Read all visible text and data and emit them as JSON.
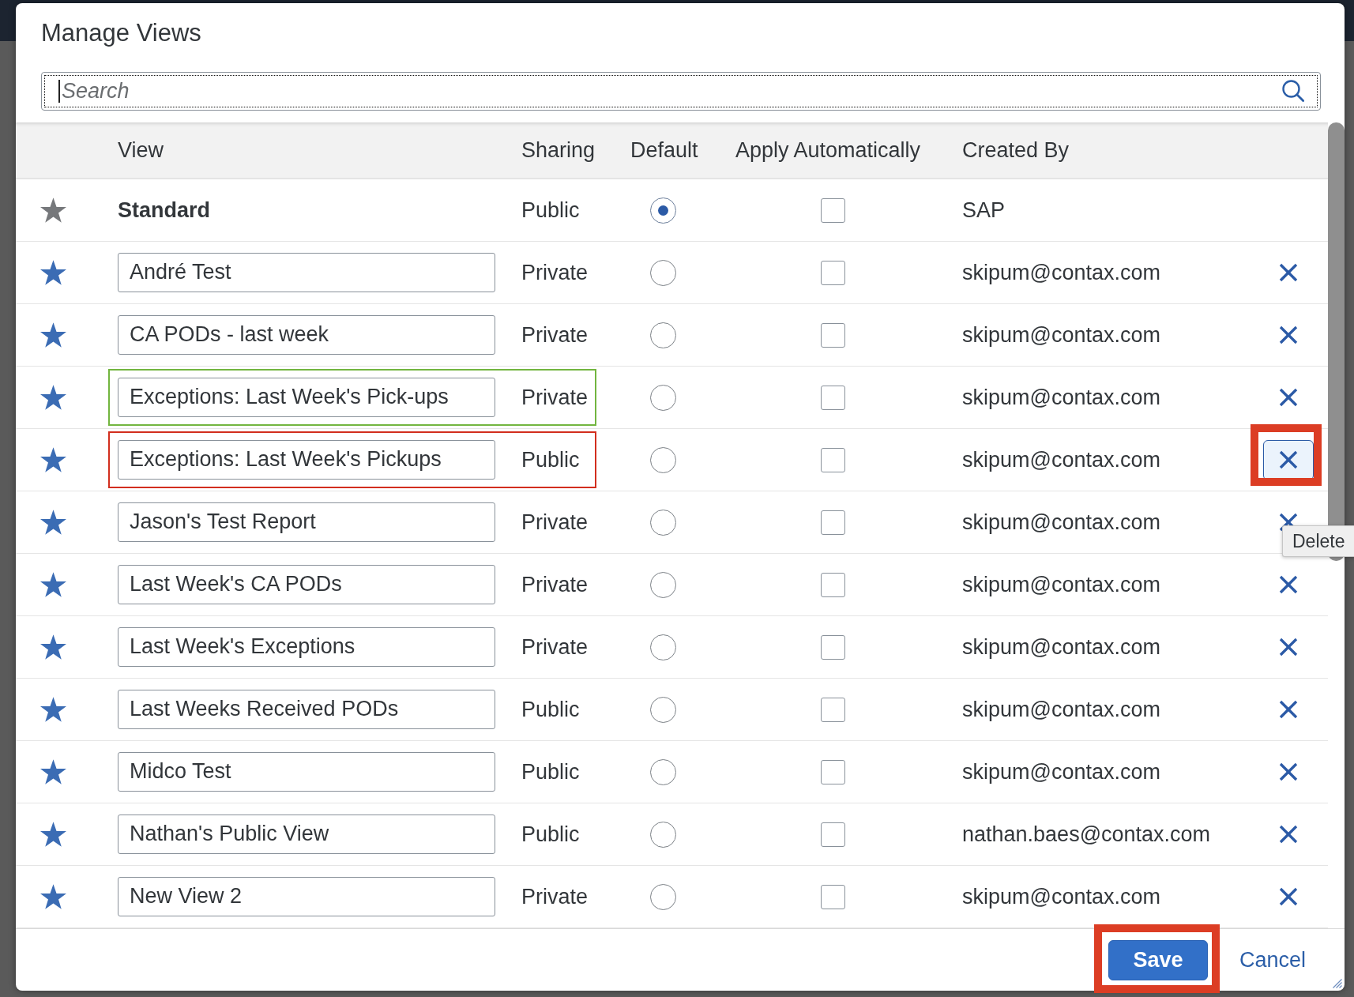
{
  "dialog": {
    "title": "Manage Views"
  },
  "search": {
    "placeholder": "Search",
    "focused": true
  },
  "table": {
    "columns": [
      "View",
      "Sharing",
      "Default",
      "Apply Automatically",
      "Created By"
    ],
    "rows": [
      {
        "name": "Standard",
        "editable": false,
        "favorite": true,
        "favorite_locked": true,
        "sharing": "Public",
        "default_selected": true,
        "apply_automatically": false,
        "created_by": "SAP",
        "deletable": false
      },
      {
        "name": "André Test",
        "editable": true,
        "favorite": true,
        "favorite_locked": false,
        "sharing": "Private",
        "default_selected": false,
        "apply_automatically": false,
        "created_by": "skipum@contax.com",
        "deletable": true,
        "delete_focused": false,
        "delete_highlighted": false
      },
      {
        "name": "CA PODs - last week",
        "editable": true,
        "favorite": true,
        "favorite_locked": false,
        "sharing": "Private",
        "default_selected": false,
        "apply_automatically": false,
        "created_by": "skipum@contax.com",
        "deletable": true,
        "delete_focused": false,
        "delete_highlighted": false
      },
      {
        "name": "Exceptions: Last Week's Pick-ups",
        "editable": true,
        "favorite": true,
        "favorite_locked": false,
        "sharing": "Private",
        "default_selected": false,
        "apply_automatically": false,
        "created_by": "skipum@contax.com",
        "deletable": true,
        "delete_focused": false,
        "delete_highlighted": false,
        "highlight": {
          "color": "#72b53f"
        }
      },
      {
        "name": "Exceptions: Last Week's Pickups",
        "editable": true,
        "favorite": true,
        "favorite_locked": false,
        "sharing": "Public",
        "default_selected": false,
        "apply_automatically": false,
        "created_by": "skipum@contax.com",
        "deletable": true,
        "delete_focused": true,
        "delete_highlighted": true,
        "highlight": {
          "color": "#d22e1e"
        }
      },
      {
        "name": "Jason's Test Report",
        "editable": true,
        "favorite": true,
        "favorite_locked": false,
        "sharing": "Private",
        "default_selected": false,
        "apply_automatically": false,
        "created_by": "skipum@contax.com",
        "deletable": true,
        "delete_focused": false,
        "delete_highlighted": false
      },
      {
        "name": "Last Week's CA PODs",
        "editable": true,
        "favorite": true,
        "favorite_locked": false,
        "sharing": "Private",
        "default_selected": false,
        "apply_automatically": false,
        "created_by": "skipum@contax.com",
        "deletable": true,
        "delete_focused": false,
        "delete_highlighted": false
      },
      {
        "name": "Last Week's Exceptions",
        "editable": true,
        "favorite": true,
        "favorite_locked": false,
        "sharing": "Private",
        "default_selected": false,
        "apply_automatically": false,
        "created_by": "skipum@contax.com",
        "deletable": true,
        "delete_focused": false,
        "delete_highlighted": false
      },
      {
        "name": "Last Weeks Received PODs",
        "editable": true,
        "favorite": true,
        "favorite_locked": false,
        "sharing": "Public",
        "default_selected": false,
        "apply_automatically": false,
        "created_by": "skipum@contax.com",
        "deletable": true,
        "delete_focused": false,
        "delete_highlighted": false
      },
      {
        "name": "Midco Test",
        "editable": true,
        "favorite": true,
        "favorite_locked": false,
        "sharing": "Public",
        "default_selected": false,
        "apply_automatically": false,
        "created_by": "skipum@contax.com",
        "deletable": true,
        "delete_focused": false,
        "delete_highlighted": false
      },
      {
        "name": "Nathan's Public View",
        "editable": true,
        "favorite": true,
        "favorite_locked": false,
        "sharing": "Public",
        "default_selected": false,
        "apply_automatically": false,
        "created_by": "nathan.baes@contax.com",
        "deletable": true,
        "delete_focused": false,
        "delete_highlighted": false
      },
      {
        "name": "New View 2",
        "editable": true,
        "favorite": true,
        "favorite_locked": false,
        "sharing": "Private",
        "default_selected": false,
        "apply_automatically": false,
        "created_by": "skipum@contax.com",
        "deletable": true,
        "delete_focused": false,
        "delete_highlighted": false
      }
    ]
  },
  "tooltip": {
    "text": "Delete"
  },
  "buttons": [
    {
      "label": "Save",
      "kind": "primary",
      "highlighted": true
    },
    {
      "label": "Cancel",
      "kind": "transparent",
      "highlighted": false
    }
  ]
}
